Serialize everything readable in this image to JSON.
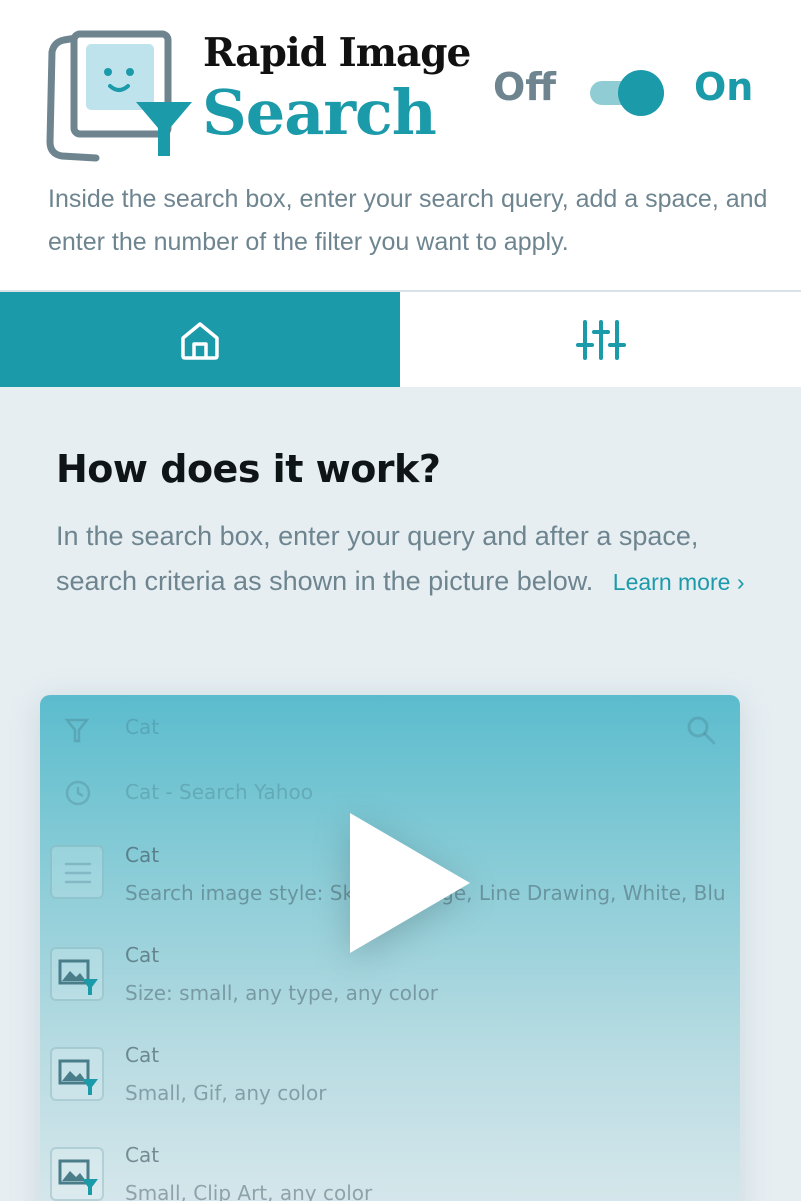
{
  "brand": {
    "line1": "Rapid Image",
    "line2": "Search"
  },
  "toggle": {
    "off_label": "Off",
    "on_label": "On",
    "state": "on"
  },
  "intro_text": "Inside the search box, enter your search query, add a space, and enter the number of the filter you want to apply.",
  "tabs": [
    {
      "name": "home",
      "icon": "home-icon",
      "active": true
    },
    {
      "name": "filters",
      "icon": "sliders-icon",
      "active": false
    }
  ],
  "how": {
    "title": "How does it work?",
    "text": "In the search box, enter your query and after a space, search criteria as shown in the picture below.",
    "learn_more": "Learn more"
  },
  "video": {
    "search_value": "Cat",
    "history_item": "Cat  -  Search Yahoo",
    "suggestions": [
      {
        "title": "Cat",
        "subtitle": "Search image style: Sketch, Large, Line Drawing, White, Blu",
        "icon": "sliders-icon"
      },
      {
        "title": "Cat",
        "subtitle": "Size: small, any type, any color",
        "icon": "image-filter-icon"
      },
      {
        "title": "Cat",
        "subtitle": "Small, Gif, any color",
        "icon": "image-filter-icon"
      },
      {
        "title": "Cat",
        "subtitle": "Small, Clip Art, any color",
        "icon": "image-filter-icon"
      }
    ],
    "play_icon": "play-icon"
  },
  "colors": {
    "accent": "#1b9aaa",
    "muted_text": "#6e8590",
    "content_bg": "#e6eef2"
  }
}
